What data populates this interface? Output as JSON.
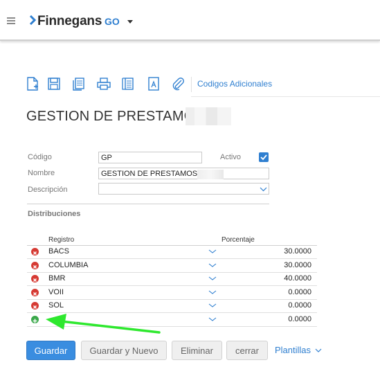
{
  "header": {
    "brand": "Finnegans",
    "brand_suffix": "GO"
  },
  "toolbar": {
    "codigos_label": "Codigos Adicionales"
  },
  "page": {
    "title": "GESTION DE PRESTAMOS"
  },
  "form": {
    "codigo_label": "Código",
    "codigo_value": "GP",
    "activo_label": "Activo",
    "activo_checked": true,
    "nombre_label": "Nombre",
    "nombre_value": "GESTION DE PRESTAMOS",
    "descripcion_label": "Descripción",
    "descripcion_value": ""
  },
  "distribuciones": {
    "label": "Distribuciones",
    "col_registro": "Registro",
    "col_porcentaje": "Porcentaje",
    "rows": [
      {
        "registro": "BACS",
        "porcentaje": "30.0000"
      },
      {
        "registro": "COLUMBIA",
        "porcentaje": "30.0000"
      },
      {
        "registro": "BMR",
        "porcentaje": "40.0000"
      },
      {
        "registro": "VOII",
        "porcentaje": "0.0000"
      },
      {
        "registro": "SOL",
        "porcentaje": "0.0000"
      }
    ],
    "new_row_porcentaje": "0.0000"
  },
  "actions": {
    "guardar": "Guardar",
    "guardar_nuevo": "Guardar y Nuevo",
    "eliminar": "Eliminar",
    "cerrar": "cerrar",
    "plantillas": "Plantillas"
  },
  "colors": {
    "accent": "#2f7fd0",
    "primary_button": "#3a8de0",
    "delete_icon": "#d63b34",
    "add_icon": "#3aa84a",
    "annotation_arrow": "#2ee82e"
  }
}
